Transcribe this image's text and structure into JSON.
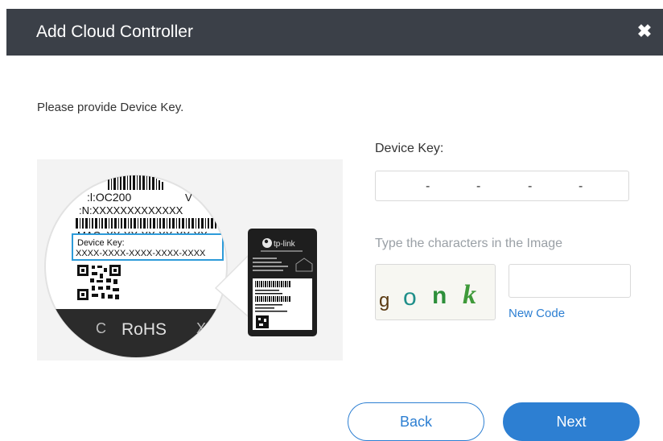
{
  "dialog": {
    "title": "Add Cloud Controller",
    "close_glyph": "✖"
  },
  "prompt": "Please provide Device Key.",
  "device_label": {
    "model_line": ":l:OC200",
    "ver_line": "V",
    "sn_line": ":N:XXXXXXXXXXXXX",
    "mac_line": "MAC: XX-XX-XX-XX-XX-XX",
    "key_caption": "Device Key:",
    "key_value": "XXXX-XXXX-XXXX-XXXX-XXXX",
    "rohs": "RoHS",
    "brand": "tp-link"
  },
  "form": {
    "device_key_label": "Device Key:",
    "dash": "-",
    "captcha_label": "Type the characters in the Image",
    "captcha_value": "",
    "new_code_label": "New Code",
    "captcha_chars": [
      "g",
      "o",
      "n",
      "k"
    ]
  },
  "buttons": {
    "back_label": "Back",
    "next_label": "Next"
  },
  "colors": {
    "header_bg": "#3b4048",
    "accent": "#2d7fd2"
  }
}
